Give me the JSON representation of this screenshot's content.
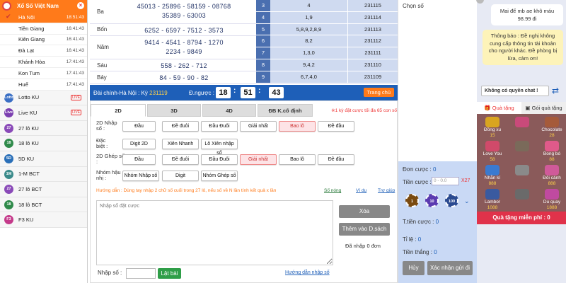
{
  "sidebar": {
    "title": "Xổ Số Việt Nam",
    "provinces": [
      {
        "name": "Hà Nội",
        "time": "18:51:43",
        "active": true
      },
      {
        "name": "Tiền Giang",
        "time": "16:41:43"
      },
      {
        "name": "Kiên Giang",
        "time": "16:41:43"
      },
      {
        "name": "Đà Lạt",
        "time": "16:41:43"
      },
      {
        "name": "Khánh Hòa",
        "time": "17:41:43"
      },
      {
        "name": "Kon Tum",
        "time": "17:41:43"
      },
      {
        "name": "Huế",
        "time": "17:41:43"
      }
    ],
    "games": [
      {
        "name": "Lotto KU",
        "icon": "lotto-icon",
        "badge": "LIVE",
        "color": "#3a6fc4",
        "icontext": "Lotto"
      },
      {
        "name": "Live KU",
        "icon": "live-icon",
        "badge": "LIVE",
        "color": "#7b3fb0",
        "icontext": "Live"
      },
      {
        "name": "27 lô KU",
        "icon": "27-icon",
        "color": "#8a4ab8",
        "icontext": "27"
      },
      {
        "name": "18 lô KU",
        "icon": "18-icon",
        "color": "#2f8a4a",
        "icontext": "18"
      },
      {
        "name": "5D KU",
        "icon": "5d-icon",
        "color": "#2a6fb8",
        "icontext": "5D"
      },
      {
        "name": "1-M BCT",
        "icon": "1m-icon",
        "color": "#3a8a8a",
        "icontext": "1M"
      },
      {
        "name": "27 lô BCT",
        "icon": "27b-icon",
        "color": "#8a4ab8",
        "icontext": "27"
      },
      {
        "name": "18 lô BCT",
        "icon": "18b-icon",
        "color": "#2f8a4a",
        "icontext": "18"
      },
      {
        "name": "F3 KU",
        "icon": "f3-icon",
        "color": "#c43a8a",
        "icontext": "F3"
      }
    ]
  },
  "results": {
    "rows": [
      {
        "prize": "Ba",
        "lines": [
          "45013 - 25896 - 58159 - 08768",
          "35389 - 63003"
        ]
      },
      {
        "prize": "Bốn",
        "lines": [
          "6252 - 6597 - 7512 - 3573"
        ]
      },
      {
        "prize": "Năm",
        "lines": [
          "9414 - 4541 - 8794 - 1270",
          "2234 - 9849"
        ]
      },
      {
        "prize": "Sáu",
        "lines": [
          "558 - 262 - 712"
        ]
      },
      {
        "prize": "Bảy",
        "lines": [
          "84 - 59 - 90 - 82"
        ]
      }
    ],
    "table": [
      {
        "n": "3",
        "v": "4",
        "k": "231115"
      },
      {
        "n": "4",
        "v": "1,9",
        "k": "231114"
      },
      {
        "n": "5",
        "v": "5,8,9,2,8,9",
        "k": "231113"
      },
      {
        "n": "6",
        "v": "8,2",
        "k": "231112"
      },
      {
        "n": "7",
        "v": "1,3,0",
        "k": "231111"
      },
      {
        "n": "8",
        "v": "9,4,2",
        "k": "231110"
      },
      {
        "n": "9",
        "v": "6,7,4,0",
        "k": "231109"
      }
    ]
  },
  "countdown": {
    "station": "Đài chính-Hà Nội : Kỳ",
    "period": "231119",
    "label": "Đ.ngược :",
    "hh": "18",
    "mm": "51",
    "ss": "43",
    "home": "Trang chủ"
  },
  "bet": {
    "tabs": [
      "2D",
      "3D",
      "4D",
      "ĐB K.cố định"
    ],
    "note": "※1 kỳ đặt cược tối đa 65 con số",
    "rows": [
      {
        "label1": "2D Nhập",
        "label2": "số :",
        "opts": [
          "Đầu",
          "Đề đuôi",
          "Đầu Đuôi",
          "Giải nhất",
          "Bao lô",
          "Đề đầu"
        ],
        "selected": 4
      },
      {
        "label1": "Đặc",
        "label2": "biệt :",
        "opts": [
          "Digit 2D",
          "Xiên Nhanh",
          "Lô Xiên nhập số"
        ],
        "selected": -1
      },
      {
        "label1": "2D Ghép số",
        "label2": ":",
        "opts": [
          "Đầu",
          "Đề đuôi",
          "Đầu Đuôi",
          "Giải nhất",
          "Bao lô",
          "Đề đầu"
        ],
        "selected": 3
      },
      {
        "label1": "Nhóm hậu",
        "label2": "nhị :",
        "opts": [
          "Nhóm Nhập số",
          "Digit",
          "Nhóm Ghép số"
        ],
        "selected": -1
      }
    ],
    "guide": "Hướng dẫn : Dùng tay nhập 2 chữ số cuối trong 27 lô, nếu số về N lần tính kết quả x lần",
    "links": [
      "Số nóng",
      "Ví dụ",
      "Trợ giúp"
    ],
    "placeholder": "Nhập số đặt cược",
    "clear": "Xóa",
    "add": "Thêm vào D.sách",
    "entered": "Đã nhập 0 đơn",
    "input_label": "Nhập số :",
    "flip": "Lật bài",
    "input_guide": "Hướng dẫn nhập số"
  },
  "middle": {
    "chonso": "Chọn số",
    "don": "Đơn cược :",
    "don_val": "0",
    "tien": "Tiền cược :",
    "tien_placeholder": "0 - 0.0",
    "mult": "X27",
    "chips": [
      "1",
      "10",
      "100"
    ],
    "ttien": "T.tiền cược :",
    "ttien_val": "0",
    "tile": "Tỉ lệ :",
    "tile_val": "0",
    "thang": "Tiền thắng :",
    "thang_val": "0",
    "cancel": "Hủy",
    "confirm": "Xác nhận gửi đi"
  },
  "chat": {
    "msg1": "Mai để mb ae khô máu 98.99 đi",
    "msg2": "Thông báo : Đề nghị không cung cấp thông tin tài khoản cho người khác. Đề phòng bị lừa, cảm ơn!",
    "noperm": "Không có quyền chat !",
    "gift_tabs": [
      "Quà tặng",
      "Gói quà tặng"
    ],
    "gifts": [
      {
        "name": "Đồng xu",
        "cost": "15"
      },
      {
        "name": "",
        "cost": ""
      },
      {
        "name": "Chocolate",
        "cost": "28"
      },
      {
        "name": "Love You",
        "cost": "58"
      },
      {
        "name": "",
        "cost": ""
      },
      {
        "name": "Bong bó",
        "cost": "88"
      },
      {
        "name": "Nhẫn kí",
        "cost": "888"
      },
      {
        "name": "",
        "cost": ""
      },
      {
        "name": "Đôi cánh",
        "cost": "888"
      },
      {
        "name": "Lambor",
        "cost": "1088"
      },
      {
        "name": "",
        "cost": ""
      },
      {
        "name": "Du quay",
        "cost": "1888"
      }
    ],
    "free": "Quà tặng miễn phí : 0"
  }
}
